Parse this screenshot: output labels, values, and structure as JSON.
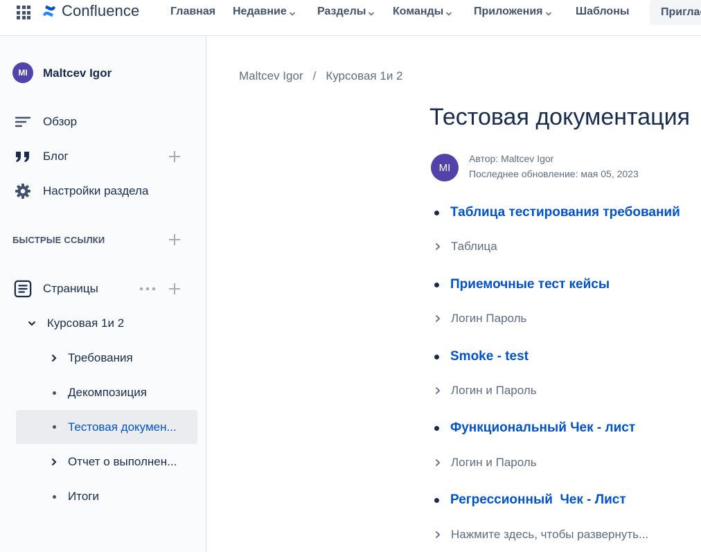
{
  "topnav": {
    "logo_text": "Confluence",
    "menu": [
      {
        "label": "Главная",
        "dropdown": false
      },
      {
        "label": "Недавние",
        "dropdown": true
      },
      {
        "label": "Разделы",
        "dropdown": true
      },
      {
        "label": "Команды",
        "dropdown": true
      },
      {
        "label": "Приложения",
        "dropdown": true
      },
      {
        "label": "Шаблоны",
        "dropdown": false
      }
    ],
    "invite_label": "Пригласить"
  },
  "sidebar": {
    "space": {
      "avatar_initials": "MI",
      "name": "Maltcev Igor"
    },
    "nav": [
      {
        "label": "Обзор",
        "icon": "overview-icon"
      },
      {
        "label": "Блог",
        "icon": "quote-icon"
      },
      {
        "label": "Настройки раздела",
        "icon": "gear-icon"
      }
    ],
    "quick_links_heading": "БЫСТРЫЕ ССЫЛКИ",
    "pages_label": "Страницы",
    "tree": [
      {
        "label": "Курсовая 1и 2",
        "marker": "chevron-down"
      },
      {
        "label": "Требования",
        "marker": "chevron-right"
      },
      {
        "label": "Декомпозиция",
        "marker": "bullet"
      },
      {
        "label": "Тестовая докумен...",
        "marker": "bullet",
        "selected": true
      },
      {
        "label": "Отчет о выполнен...",
        "marker": "chevron-right"
      },
      {
        "label": "Итоги",
        "marker": "bullet"
      }
    ]
  },
  "breadcrumb": [
    "Maltcev Igor",
    "Курсовая 1и 2"
  ],
  "breadcrumb_separator": "/",
  "page": {
    "title": "Тестовая документация",
    "author_initials": "MI",
    "author_line": "Автор: Maltcev Igor",
    "updated_line": "Последнее обновление: мая 05, 2023",
    "items": [
      {
        "title": "Таблица тестирования требований",
        "expand": "Таблица"
      },
      {
        "title": "Приемочные тест кейсы",
        "expand": "Логин Пароль"
      },
      {
        "title": "Smoke - test",
        "expand": "Логин и Пароль"
      },
      {
        "title": "Функциональный Чек - лист",
        "expand": "Логин и Пароль"
      },
      {
        "title": "Регрессионный  Чек - Лист",
        "expand": "Нажмите здесь, чтобы развернуть..."
      }
    ]
  },
  "colors": {
    "accent": "#0052cc",
    "avatar": "#5243aa",
    "text": "#172b4d",
    "muted": "#5e6c84"
  }
}
